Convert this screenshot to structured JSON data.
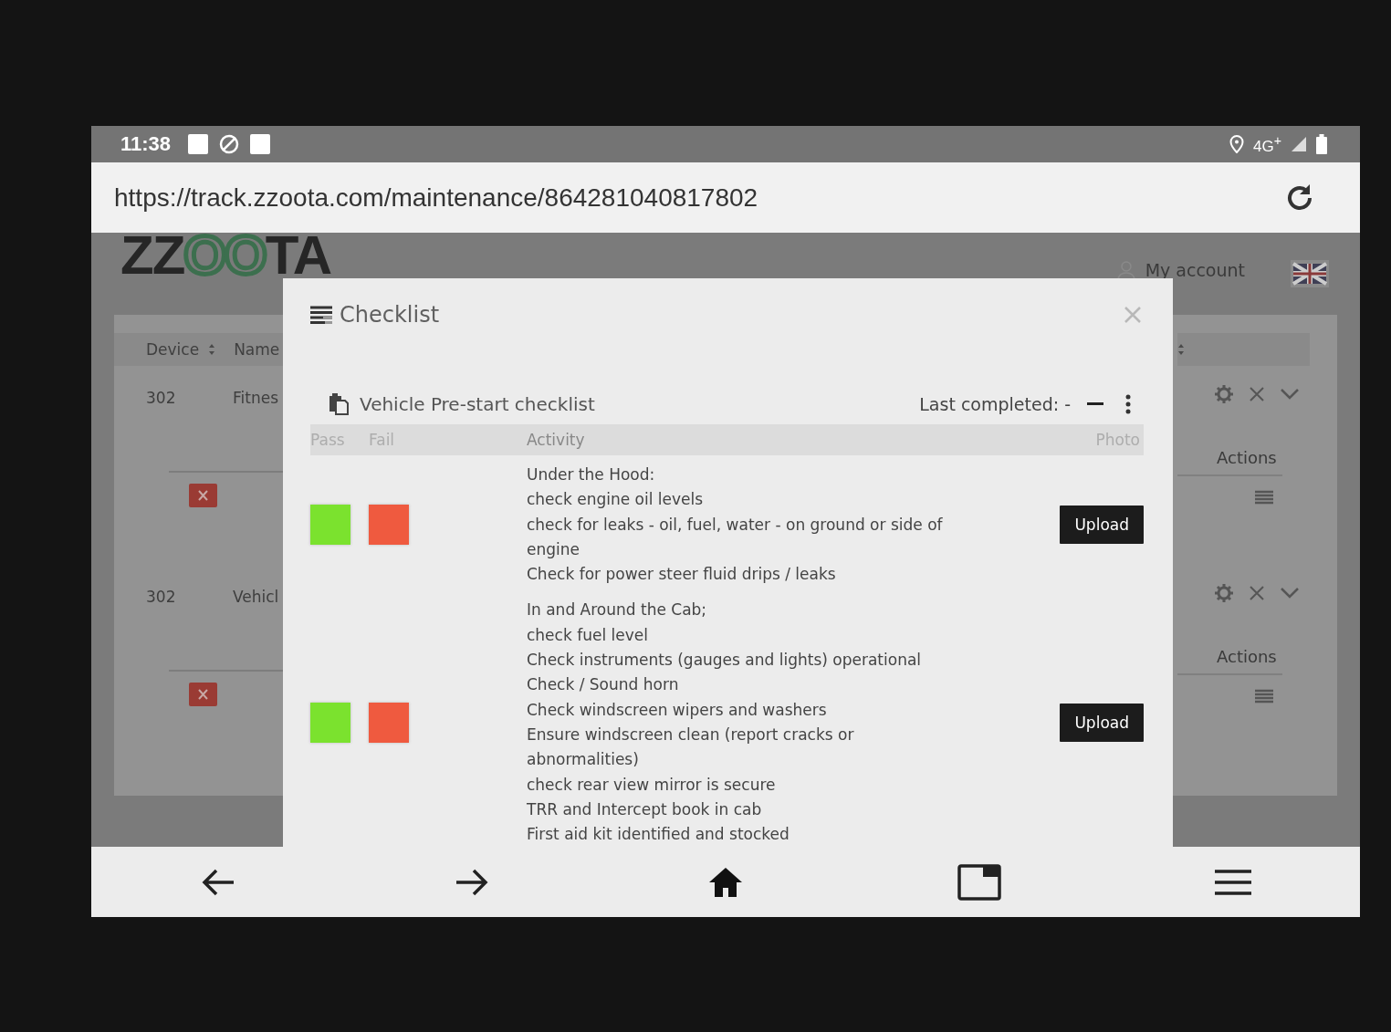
{
  "status_bar": {
    "time": "11:38",
    "network": "4G$^{+}$"
  },
  "address_bar": {
    "url": "https://track.zzoota.com/maintenance/864281040817802"
  },
  "site_header": {
    "logo": [
      {
        "text": "ZZ",
        "kind": "plain"
      },
      {
        "text": "OO",
        "kind": "accent"
      },
      {
        "text": "TA",
        "kind": "plain"
      }
    ],
    "account_link": "My account"
  },
  "background_table": {
    "columns": [
      "Device",
      "Name"
    ],
    "rows": [
      {
        "device": "302",
        "name": "Fitnes",
        "actions_label": "Actions"
      },
      {
        "device": "302",
        "name": "Vehicl",
        "actions_label": "Actions"
      }
    ]
  },
  "modal": {
    "title": "Checklist",
    "checklist": {
      "name": "Vehicle Pre-start checklist",
      "last_completed": "Last completed: -",
      "columns": [
        "Pass",
        "Fail",
        "Activity",
        "Photo"
      ],
      "items": [
        {
          "lines": [
            "Under the Hood:",
            "check engine oil levels",
            "check for leaks - oil, fuel, water - on ground or side of engine",
            "Check for power steer fluid drips / leaks"
          ],
          "photo_button": "Upload"
        },
        {
          "lines": [
            "In and Around the Cab;",
            "check fuel level",
            "Check instruments (gauges and lights) operational",
            "Check / Sound horn",
            "Check windscreen wipers and washers",
            "Ensure windscreen clean (report cracks or abnormalities)",
            "check rear view mirror is secure",
            "TRR and Intercept book in cab",
            "First aid kit identified and stocked"
          ],
          "photo_button": "Upload"
        }
      ]
    }
  }
}
